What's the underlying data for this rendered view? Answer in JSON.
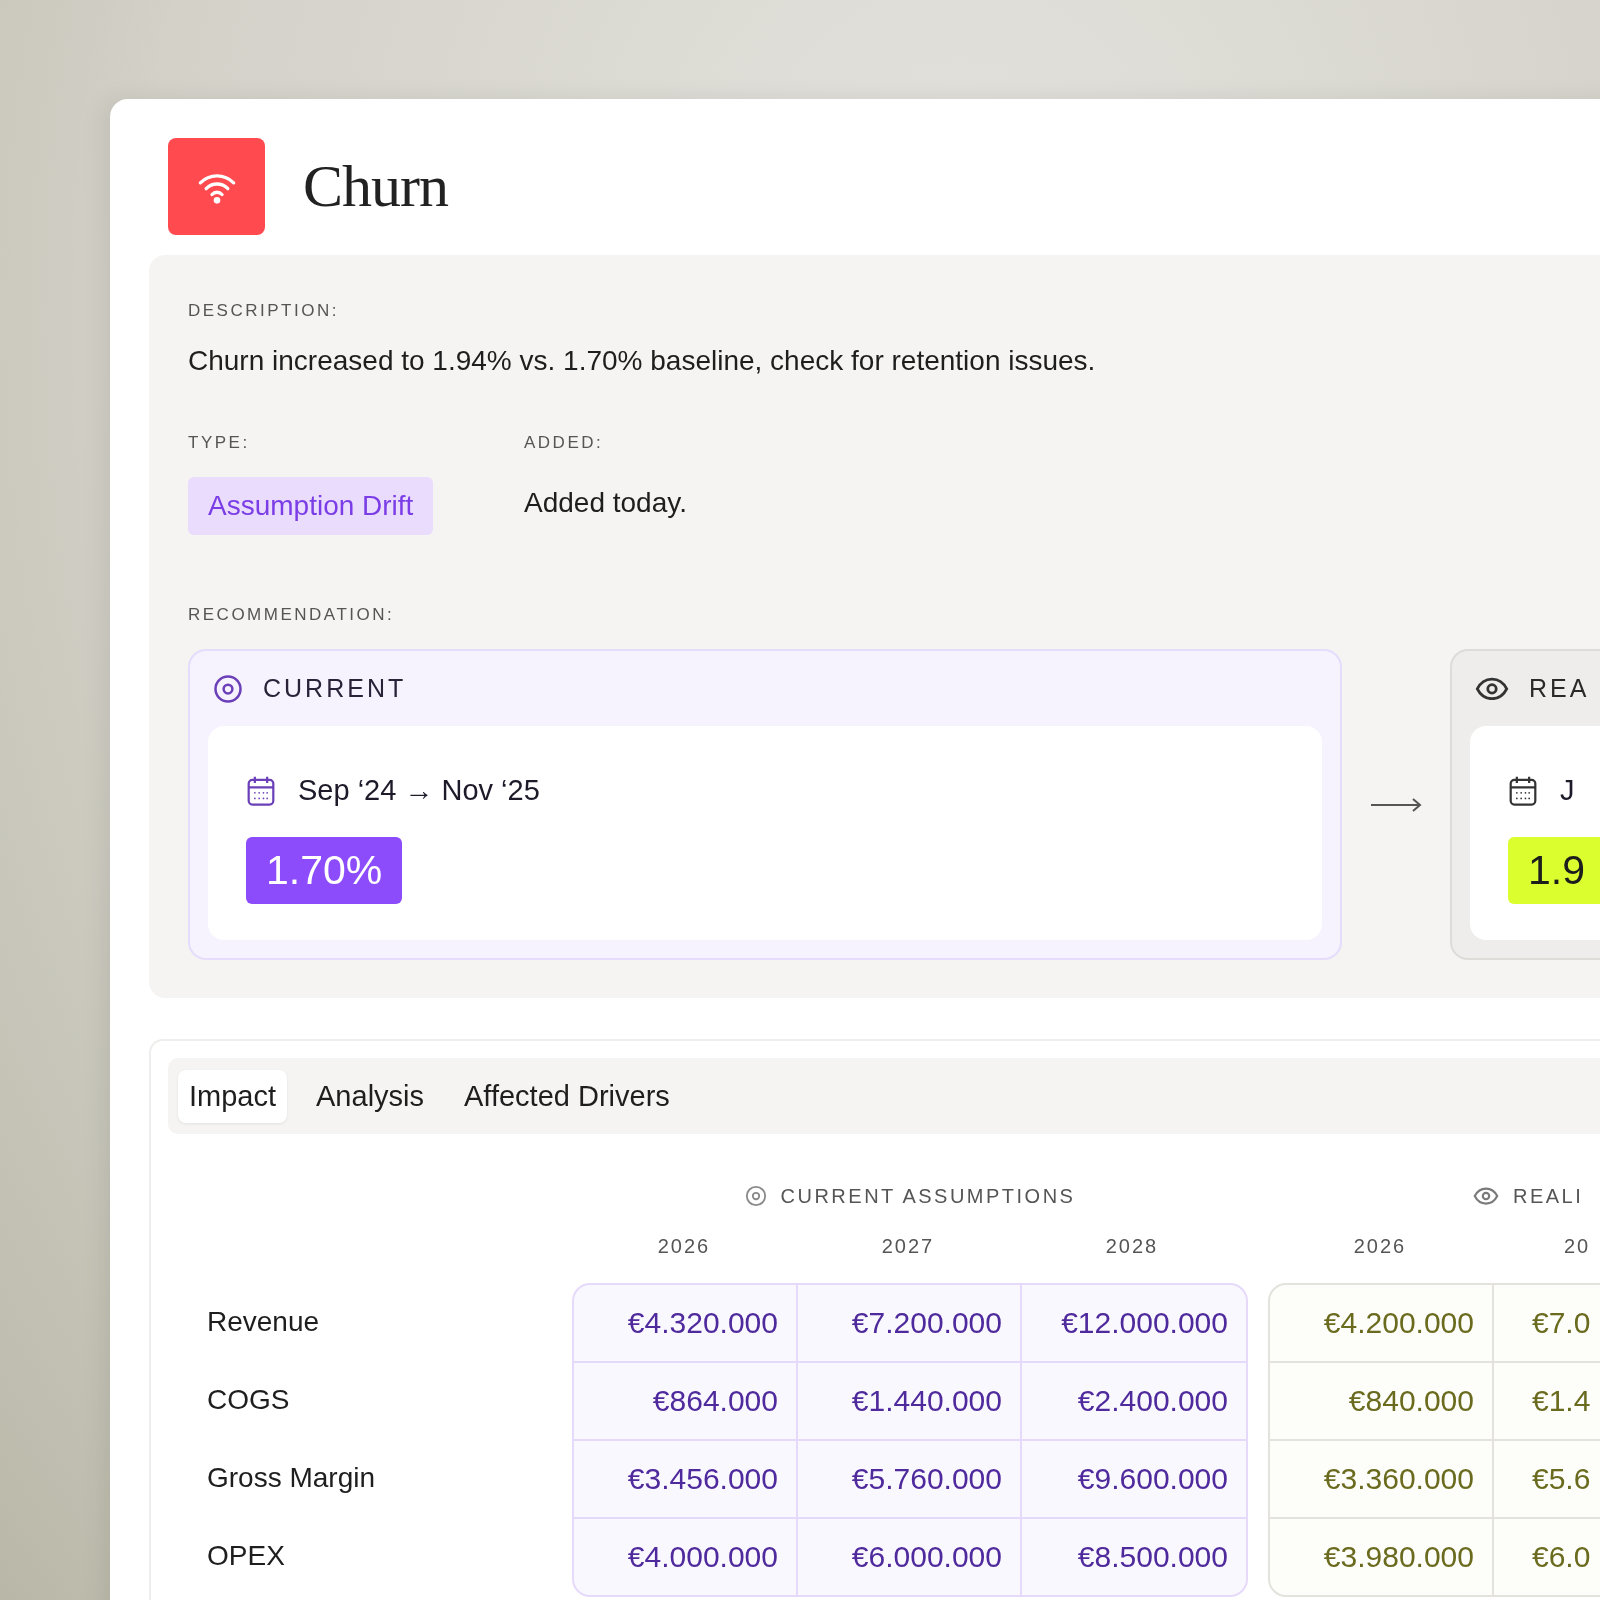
{
  "header": {
    "title": "Churn"
  },
  "description": {
    "label": "DESCRIPTION:",
    "text": "Churn increased to 1.94% vs. 1.70% baseline, check for retention issues."
  },
  "type": {
    "label": "TYPE:",
    "value": "Assumption Drift"
  },
  "added": {
    "label": "ADDED:",
    "value": "Added today."
  },
  "recommendation": {
    "label": "RECOMMENDATION:",
    "cards": [
      {
        "kind": "current",
        "title": "CURRENT",
        "period": "Sep ‘24 → Nov ‘25",
        "value": "1.70%"
      },
      {
        "kind": "reality",
        "title": "REA",
        "period": "J",
        "value": "1.9"
      }
    ]
  },
  "tabs": [
    {
      "label": "Impact",
      "selected": true
    },
    {
      "label": "Analysis",
      "selected": false
    },
    {
      "label": "Affected Drivers",
      "selected": false
    }
  ],
  "table": {
    "groups": [
      {
        "kind": "current",
        "title": "CURRENT ASSUMPTIONS",
        "years": [
          "2026",
          "2027",
          "2028"
        ]
      },
      {
        "kind": "reality",
        "title": "REALI",
        "years": [
          "2026",
          "20"
        ]
      }
    ],
    "rows": [
      {
        "label": "Revenue",
        "values": [
          [
            "€4.320.000",
            "€7.200.000",
            "€12.000.000"
          ],
          [
            "€4.200.000",
            "€7.0"
          ]
        ]
      },
      {
        "label": "COGS",
        "values": [
          [
            "€864.000",
            "€1.440.000",
            "€2.400.000"
          ],
          [
            "€840.000",
            "€1.4"
          ]
        ]
      },
      {
        "label": "Gross Margin",
        "values": [
          [
            "€3.456.000",
            "€5.760.000",
            "€9.600.000"
          ],
          [
            "€3.360.000",
            "€5.6"
          ]
        ]
      },
      {
        "label": "OPEX",
        "values": [
          [
            "€4.000.000",
            "€6.000.000",
            "€8.500.000"
          ],
          [
            "€3.980.000",
            "€6.0"
          ]
        ]
      }
    ]
  }
}
